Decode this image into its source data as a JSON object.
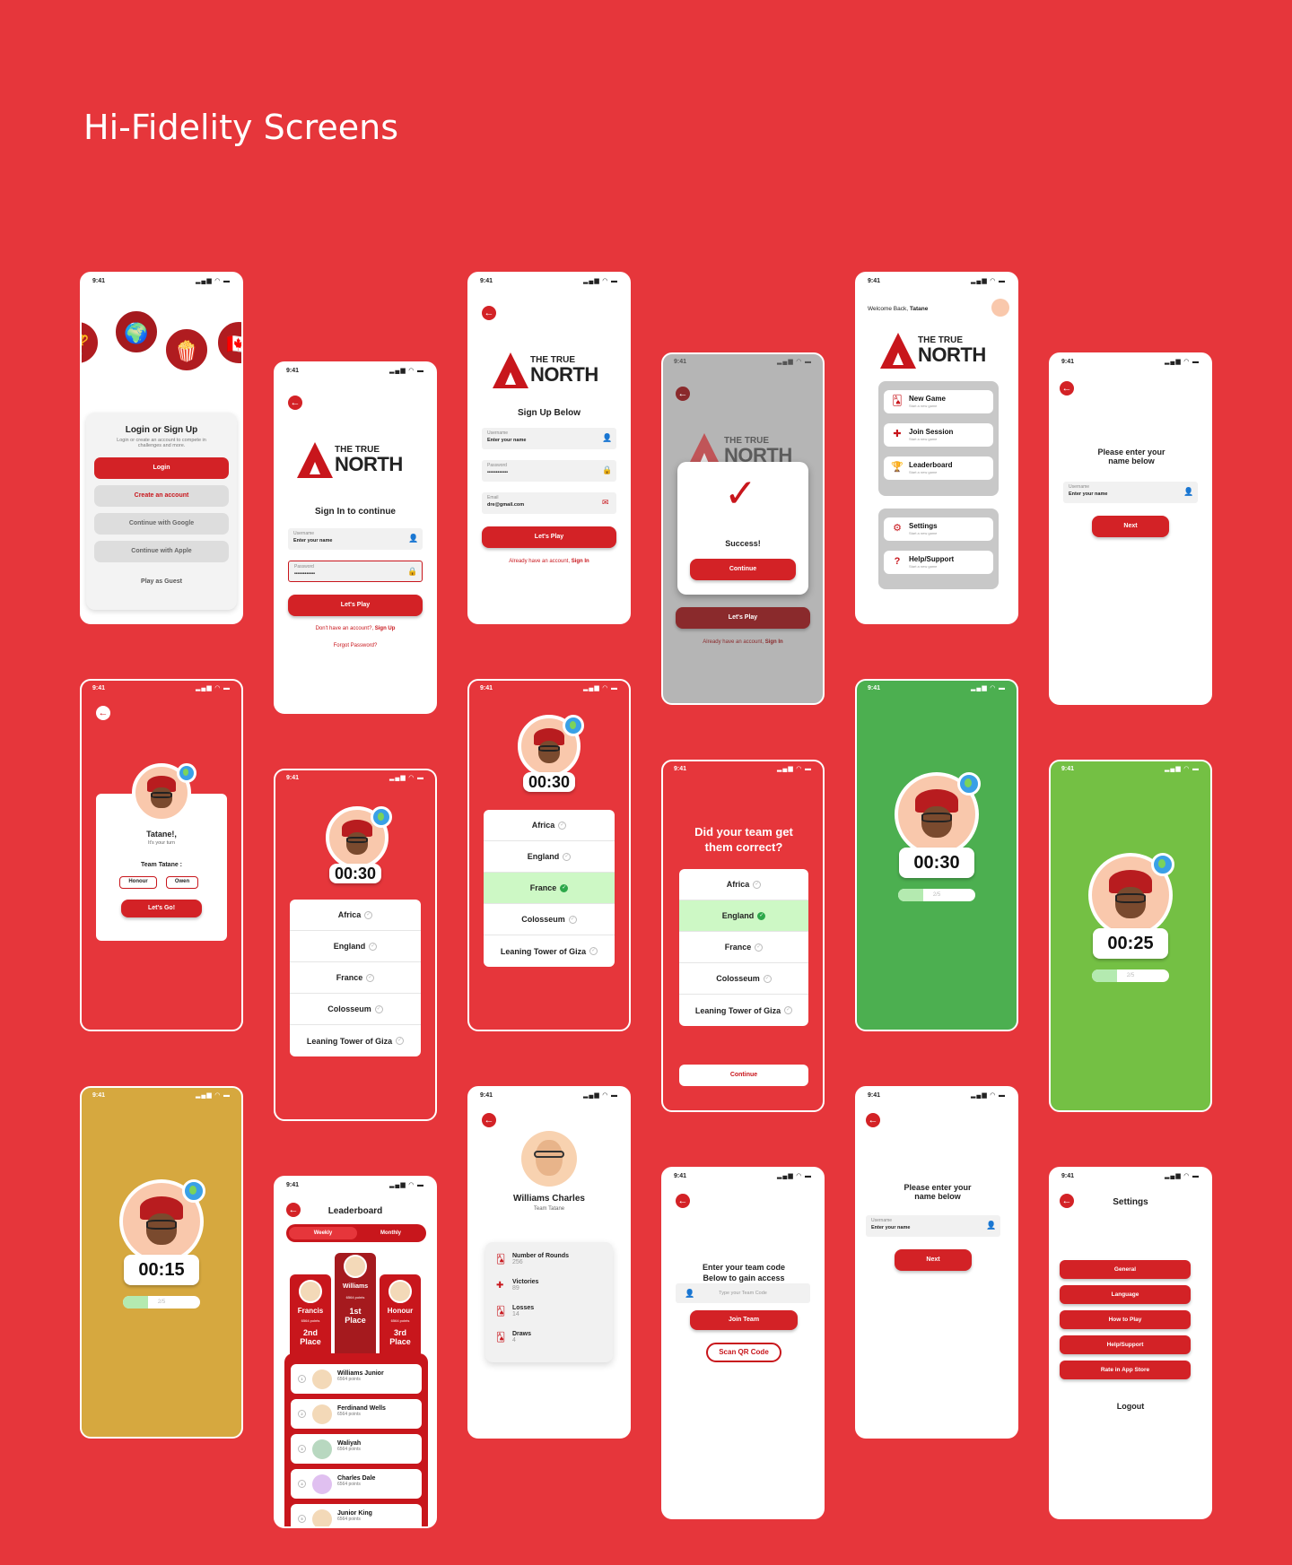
{
  "page_title": "Hi-Fidelity Screens",
  "status_time": "9:41",
  "status_icons": "▂▄▆ ◠ ▬",
  "back_glyph": "←",
  "logo": {
    "line1": "THE TRUE",
    "line2": "NORTH"
  },
  "login": {
    "title": "Login or Sign Up",
    "subtitle": "Login or create an account to compete in challenges and more.",
    "login_btn": "Login",
    "create_btn": "Create an account",
    "google_btn": "Continue with Google",
    "apple_btn": "Continue with Apple",
    "guest": "Play as Guest"
  },
  "signin": {
    "heading": "Sign In to continue",
    "username_label": "Username",
    "username_value": "Enter your name",
    "password_label": "Password",
    "password_value": "••••••••••••",
    "play_btn": "Let's Play",
    "no_account": "Don't have an account?,",
    "signup_link": "Sign Up",
    "forgot": "Forgot Password?"
  },
  "signup": {
    "heading": "Sign Up Below",
    "username_label": "Username",
    "username_value": "Enter your name",
    "password_label": "Password",
    "password_value": "••••••••••••",
    "email_label": "Email",
    "email_value": "dre@gmail.com",
    "play_btn": "Let's Play",
    "have_account": "Already have an account,",
    "signin_link": "Sign In"
  },
  "success": {
    "title": "Success!",
    "continue_btn": "Continue",
    "play_btn": "Let's Play",
    "have_account": "Already have an account,",
    "signin_link": "Sign In"
  },
  "home": {
    "welcome": "Welcome Back,",
    "user": "Tatane",
    "menu": [
      {
        "label": "New Game",
        "sub": "Start a new game"
      },
      {
        "label": "Join Session",
        "sub": "Start a new game"
      },
      {
        "label": "Leaderboard",
        "sub": "Start a new game"
      }
    ],
    "menu2": [
      {
        "label": "Settings",
        "sub": "Start a new game"
      },
      {
        "label": "Help/Support",
        "sub": "Start a new game"
      }
    ]
  },
  "name_entry": {
    "heading": "Please enter your name below",
    "username_label": "Username",
    "username_value": "Enter your name",
    "next_btn": "Next"
  },
  "turn": {
    "name": "Tatane!,",
    "sub": "It's your turn",
    "team_label": "Team Tatane :",
    "members": [
      "Honour",
      "Owen"
    ],
    "go_btn": "Let's Go!"
  },
  "quiz": {
    "timer1": "00:30",
    "timer2": "00:30",
    "timer3": "00:30",
    "timer4": "00:25",
    "timer5": "00:15",
    "items": [
      "Africa",
      "England",
      "France",
      "Colosseum",
      "Leaning Tower of Giza"
    ],
    "progress_label": "2/5",
    "progress_frac": 0.33
  },
  "correct": {
    "heading": "Did your team get them correct?",
    "continue_btn": "Continue"
  },
  "profile": {
    "name": "Williams Charles",
    "team": "Team Tatane",
    "stats": [
      {
        "label": "Number of Rounds",
        "value": "256"
      },
      {
        "label": "Victories",
        "value": "89"
      },
      {
        "label": "Losses",
        "value": "14"
      },
      {
        "label": "Draws",
        "value": "4"
      }
    ]
  },
  "leaderboard": {
    "title": "Leaderboard",
    "tabs": [
      "Weekly",
      "Monthly"
    ],
    "podium": [
      {
        "name": "Francis",
        "pts": "6564 points",
        "place": "2nd Place"
      },
      {
        "name": "Williams",
        "pts": "6564 points",
        "place": "1st Place"
      },
      {
        "name": "Honour",
        "pts": "6564 points",
        "place": "3rd Place"
      }
    ],
    "rows": [
      {
        "n": "1",
        "name": "Williams Junior",
        "pts": "6564 points"
      },
      {
        "n": "2",
        "name": "Ferdinand Wells",
        "pts": "6564 points"
      },
      {
        "n": "3",
        "name": "Waliyah",
        "pts": "6564 points"
      },
      {
        "n": "4",
        "name": "Charles Dale",
        "pts": "6564 points"
      },
      {
        "n": "5",
        "name": "Junior King",
        "pts": "6564 points"
      }
    ]
  },
  "join": {
    "heading": "Enter your team code Below to gain access",
    "placeholder": "Type your Team Code",
    "join_btn": "Join Team",
    "qr_btn": "Scan QR Code"
  },
  "settings": {
    "title": "Settings",
    "items": [
      "General",
      "Language",
      "How to Play",
      "Help/Support",
      "Rate in App Store"
    ],
    "logout": "Logout"
  },
  "colors": {
    "brand": "#e6363b",
    "accent": "#d32226",
    "green": "#4caf50",
    "lime": "#74c044",
    "gold": "#d6a83f"
  }
}
